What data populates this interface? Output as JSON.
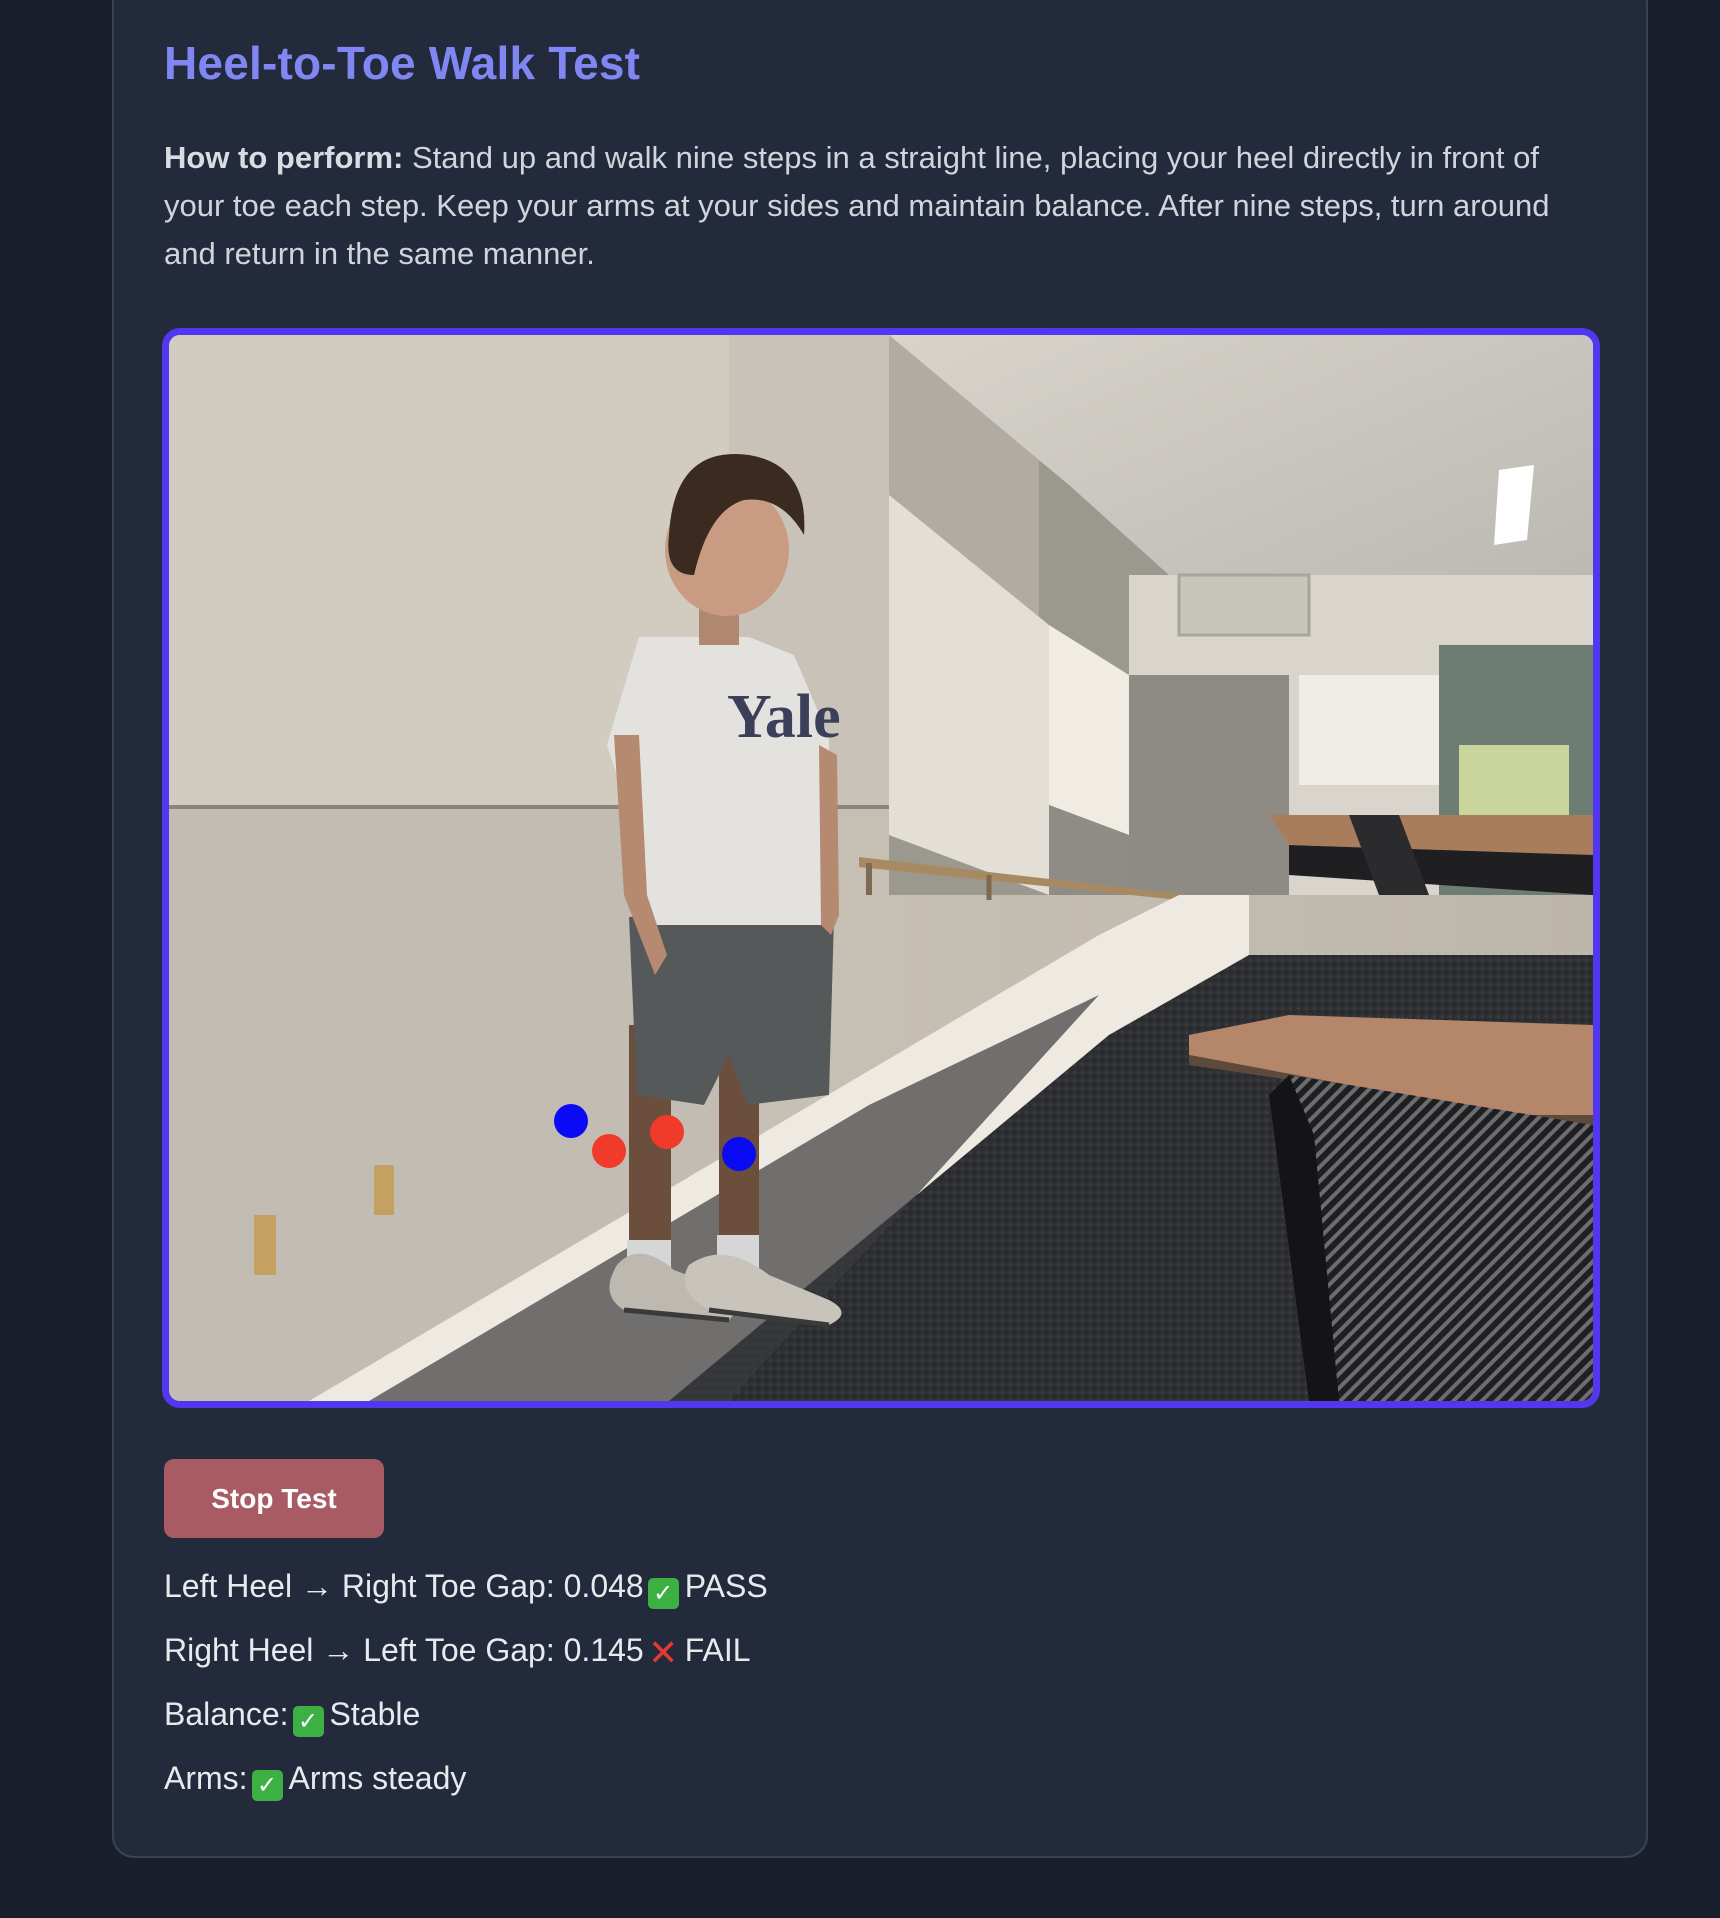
{
  "title": "Heel-to-Toe Walk Test",
  "instructions": {
    "lead": "How to perform:",
    "text": " Stand up and walk nine steps in a straight line, placing your heel directly in front of your toe each step. Keep your arms at your sides and maintain balance. After nine steps, turn around and return in the same manner."
  },
  "video": {
    "markers": [
      {
        "color": "#0a0af5",
        "label": "left-toe"
      },
      {
        "color": "#f03a2a",
        "label": "left-heel"
      },
      {
        "color": "#f03a2a",
        "label": "right-heel"
      },
      {
        "color": "#0a0af5",
        "label": "right-toe"
      }
    ],
    "shirt_text": "Yale"
  },
  "stop_button": {
    "label": "Stop Test",
    "color": "#a85b63"
  },
  "results": [
    {
      "label": "Left Heel → Right Toe Gap:",
      "value": "0.048",
      "status_icon": "check-icon",
      "status": "PASS"
    },
    {
      "label": "Right Heel → Left Toe Gap:",
      "value": "0.145",
      "status_icon": "cross-icon",
      "status": "FAIL"
    },
    {
      "label": "Balance:",
      "value": "",
      "status_icon": "check-icon",
      "status": "Stable"
    },
    {
      "label": "Arms:",
      "value": "",
      "status_icon": "check-icon",
      "status": "Arms steady"
    }
  ],
  "colors": {
    "accent": "#8187f2",
    "frame_border": "#5138f0",
    "background": "#1a1f2e",
    "card": "#222a3b",
    "pass": "#3cb043",
    "fail": "#e53935"
  }
}
